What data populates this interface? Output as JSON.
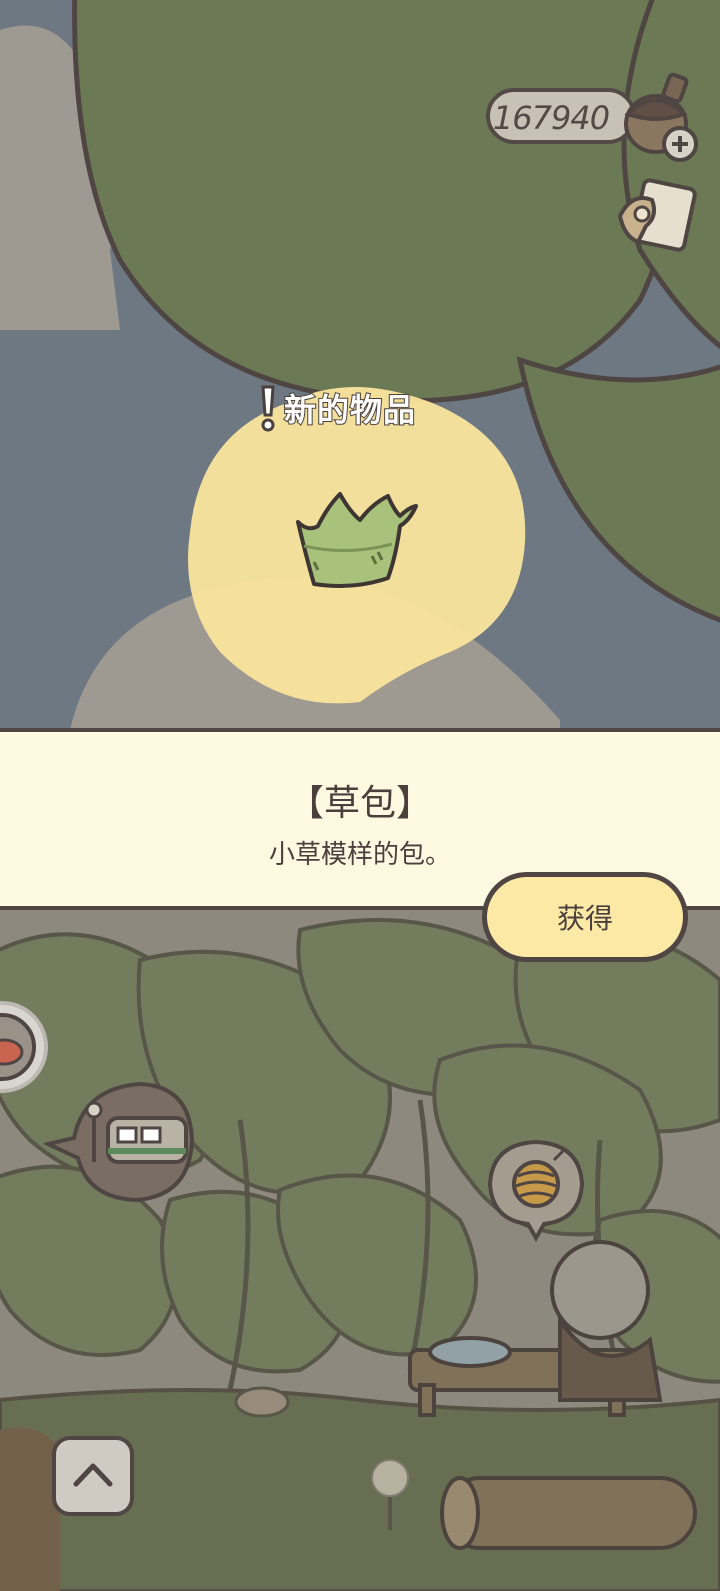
{
  "hud": {
    "currency_value": "167940",
    "currency_icon": "acorn-icon",
    "add_icon": "plus-icon",
    "map_icon": "map-icon"
  },
  "notification": {
    "label": "新的物品",
    "icon": "exclamation-icon"
  },
  "item": {
    "name": "【草包】",
    "description": "小草模样的包。",
    "icon": "grass-bag-icon"
  },
  "actions": {
    "obtain_label": "获得"
  },
  "scene_icons": [
    "train-icon",
    "yarn-ball-icon",
    "chevron-up-icon",
    "side-menu-icon"
  ],
  "colors": {
    "outline": "#4f4542",
    "panel_bg": "#fefae2",
    "button_bg": "#fde9a6",
    "highlight": "#fbe59d",
    "leaf_green": "#6b7955",
    "sky": "#6d7883"
  }
}
